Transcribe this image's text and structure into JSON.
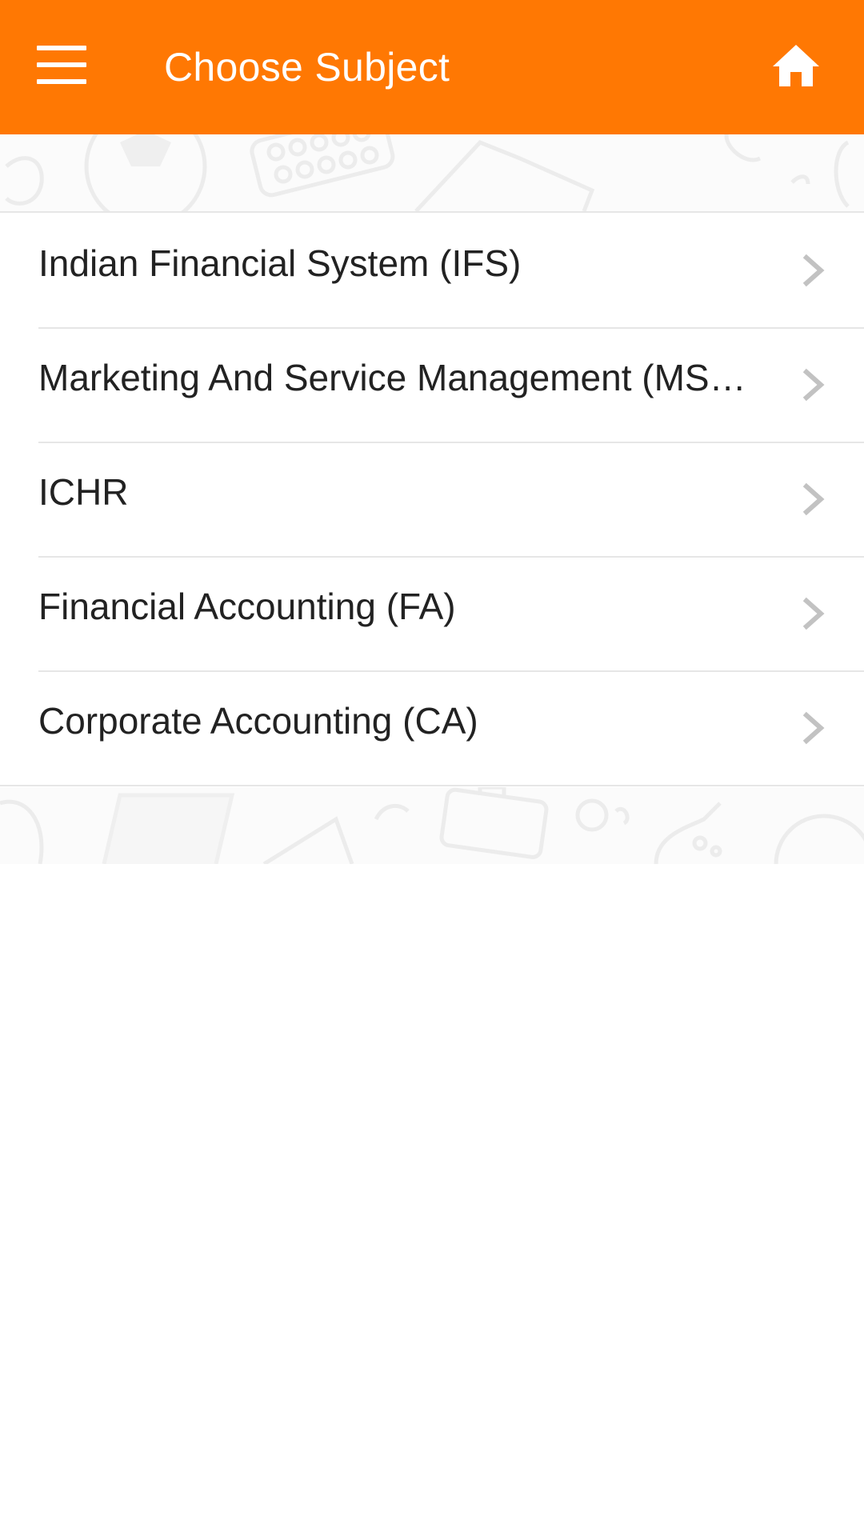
{
  "header": {
    "title": "Choose Subject",
    "menu_icon": "hamburger-menu-icon",
    "home_icon": "home-icon",
    "background_color": "#ff7803",
    "text_color": "#ffffff"
  },
  "subjects": [
    {
      "label": "Indian Financial System (IFS)",
      "icon": "chevron-right-icon"
    },
    {
      "label": "Marketing And Service Management (MS…",
      "icon": "chevron-right-icon"
    },
    {
      "label": "ICHR",
      "icon": "chevron-right-icon"
    },
    {
      "label": "Financial Accounting (FA)",
      "icon": "chevron-right-icon"
    },
    {
      "label": "Corporate Accounting (CA)",
      "icon": "chevron-right-icon"
    }
  ],
  "colors": {
    "accent": "#ff7803",
    "divider": "#e6e6e6",
    "chevron": "#c2c2c2",
    "text": "#222222"
  }
}
